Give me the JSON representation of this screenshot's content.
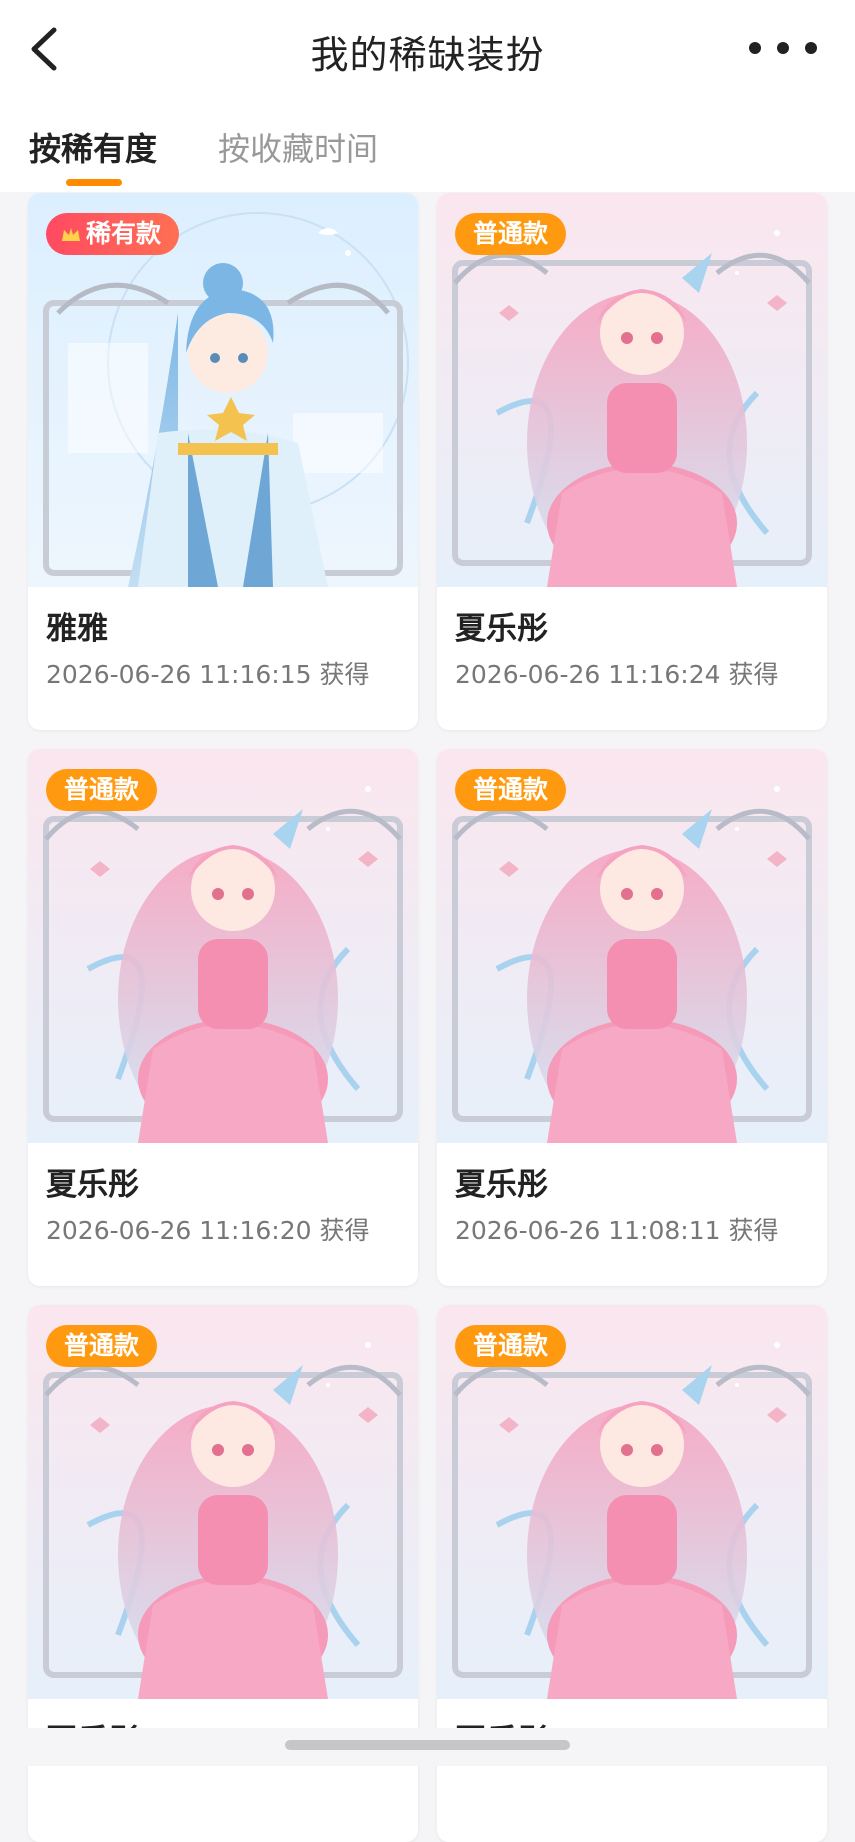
{
  "header": {
    "title": "我的稀缺装扮",
    "back_icon": "chevron-left-icon",
    "more_icon": "more-horizontal-icon"
  },
  "tabs": [
    {
      "label": "按稀有度",
      "active": true
    },
    {
      "label": "按收藏时间",
      "active": false
    }
  ],
  "accent_color": "#ff8a00",
  "cards": [
    {
      "badge": "稀有款",
      "badge_type": "rare",
      "name": "雅雅",
      "time": "2026-06-26 11:16:15 获得",
      "theme": "blue"
    },
    {
      "badge": "普通款",
      "badge_type": "normal",
      "name": "夏乐彤",
      "time": "2026-06-26 11:16:24 获得",
      "theme": "pink"
    },
    {
      "badge": "普通款",
      "badge_type": "normal",
      "name": "夏乐彤",
      "time": "2026-06-26 11:16:20 获得",
      "theme": "pink"
    },
    {
      "badge": "普通款",
      "badge_type": "normal",
      "name": "夏乐彤",
      "time": "2026-06-26 11:08:11 获得",
      "theme": "pink"
    },
    {
      "badge": "普通款",
      "badge_type": "normal",
      "name": "夏乐彤",
      "time": "",
      "theme": "pink"
    },
    {
      "badge": "普通款",
      "badge_type": "normal",
      "name": "夏乐彤",
      "time": "",
      "theme": "pink"
    }
  ]
}
